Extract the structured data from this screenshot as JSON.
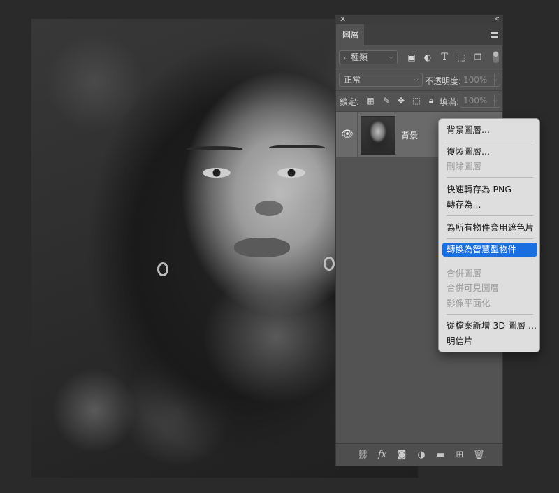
{
  "panel": {
    "tab_label": "圖層",
    "filter": {
      "kind_label": "種類"
    },
    "blend": {
      "mode": "正常",
      "opacity_label": "不透明度:",
      "opacity_value": "100%"
    },
    "lock": {
      "label": "鎖定:",
      "fill_label": "填滿:",
      "fill_value": "100%"
    },
    "layers": [
      {
        "name": "背景"
      }
    ],
    "footer_icons": [
      "link-icon",
      "fx-icon",
      "mask-icon",
      "adjustment-icon",
      "folder-icon",
      "new-layer-icon",
      "trash-icon"
    ]
  },
  "context_menu": {
    "groups": [
      [
        {
          "label": "背景圖層...",
          "enabled": true
        }
      ],
      [
        {
          "label": "複製圖層...",
          "enabled": true
        },
        {
          "label": "刪除圖層",
          "enabled": false
        }
      ],
      [
        {
          "label": "快速轉存為 PNG",
          "enabled": true
        },
        {
          "label": "轉存為...",
          "enabled": true
        }
      ],
      [
        {
          "label": "為所有物件套用遮色片",
          "enabled": true
        }
      ],
      [
        {
          "label": "轉換為智慧型物件",
          "enabled": true,
          "selected": true
        }
      ],
      [
        {
          "label": "合併圖層",
          "enabled": false
        },
        {
          "label": "合併可見圖層",
          "enabled": false
        },
        {
          "label": "影像平面化",
          "enabled": false
        }
      ],
      [
        {
          "label": "從檔案新增 3D 圖層 ...",
          "enabled": true
        },
        {
          "label": "明信片",
          "enabled": true
        }
      ]
    ]
  },
  "colors": {
    "panel_bg": "#535353",
    "menu_bg": "#dedede",
    "selection": "#1a6fe0"
  }
}
